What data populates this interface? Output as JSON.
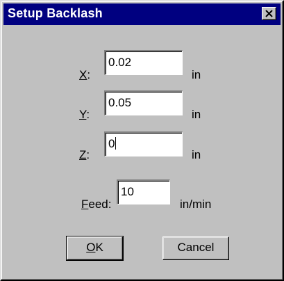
{
  "window": {
    "title": "Setup Backlash",
    "close_icon": "close-x-icon"
  },
  "fields": {
    "x": {
      "label_key": "X",
      "label_rest": ":",
      "value": "0.02",
      "unit": "in"
    },
    "y": {
      "label_key": "Y",
      "label_rest": ":",
      "value": "0.05",
      "unit": "in"
    },
    "z": {
      "label_key": "Z",
      "label_rest": ":",
      "value": "0",
      "unit": "in"
    },
    "feed": {
      "label_key": "F",
      "label_rest": "eed:",
      "value": "10",
      "unit": "in/min"
    }
  },
  "buttons": {
    "ok": {
      "key": "O",
      "rest": "K"
    },
    "cancel": {
      "label": "Cancel"
    }
  }
}
